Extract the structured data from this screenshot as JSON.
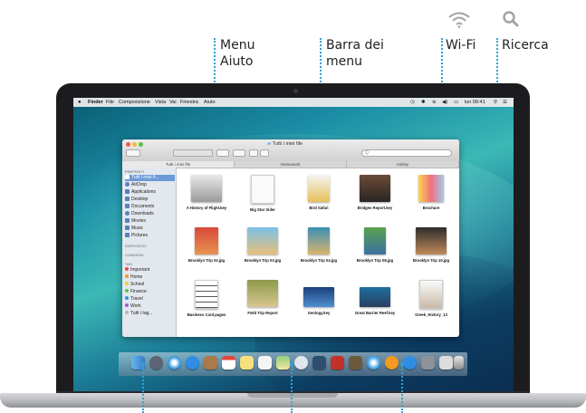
{
  "callouts": {
    "menu_aiuto": "Menu\nAiuto",
    "barra_menu": "Barra dei\nmenu",
    "wifi": "Wi-Fi",
    "ricerca": "Ricerca"
  },
  "icons": [
    "wifi-icon",
    "search-icon"
  ],
  "menubar": {
    "apple": "",
    "items": [
      "Finder",
      "File",
      "Composizione",
      "Vista",
      "Vai",
      "Finestra",
      "Aiuto"
    ],
    "clock": "lun 09:41"
  },
  "finder": {
    "title": "Tutti i miei file",
    "search_placeholder": "Q",
    "tabs": [
      "Tutti i miei file",
      "Homework",
      "Ashley"
    ],
    "sidebar": {
      "favorites_label": "PREFERITI",
      "favorites": [
        "Tutti i miei fi...",
        "AirDrop",
        "Applications",
        "Desktop",
        "Documents",
        "Downloads",
        "Movies",
        "Music",
        "Pictures"
      ],
      "shared_label": "CONDIVISI",
      "devices_label": "DISPOSITIVI",
      "tags_label": "TAG",
      "tags": [
        {
          "name": "Important",
          "color": "#f04a3c"
        },
        {
          "name": "Home",
          "color": "#f39a23"
        },
        {
          "name": "School",
          "color": "#f3d12c"
        },
        {
          "name": "Finance",
          "color": "#63c437"
        },
        {
          "name": "Travel",
          "color": "#3b8ee3"
        },
        {
          "name": "Work",
          "color": "#a35bd0"
        },
        {
          "name": "Tutti i tag...",
          "color": "#b8b8b8"
        }
      ]
    },
    "files": [
      {
        "name": "A History of Flight.key"
      },
      {
        "name": "Big Star Sider"
      },
      {
        "name": "Bird Safari"
      },
      {
        "name": "Bridges Report.key"
      },
      {
        "name": "Brochure"
      },
      {
        "name": "Brooklyn Trip 02.jpg"
      },
      {
        "name": "Brooklyn Trip 03.jpg"
      },
      {
        "name": "Brooklyn Trip 04.jpg"
      },
      {
        "name": "Brooklyn Trip 08.jpg"
      },
      {
        "name": "Brooklyn Trip 10.jpg"
      },
      {
        "name": "Business Card.pages"
      },
      {
        "name": "Field Trip Report"
      },
      {
        "name": "Geology.key"
      },
      {
        "name": "Great Barrier Reef.key"
      },
      {
        "name": "Greek_History_13"
      }
    ]
  },
  "colors": {
    "callout_line": "#2ea3d6",
    "selection": "#6d9ad8"
  }
}
